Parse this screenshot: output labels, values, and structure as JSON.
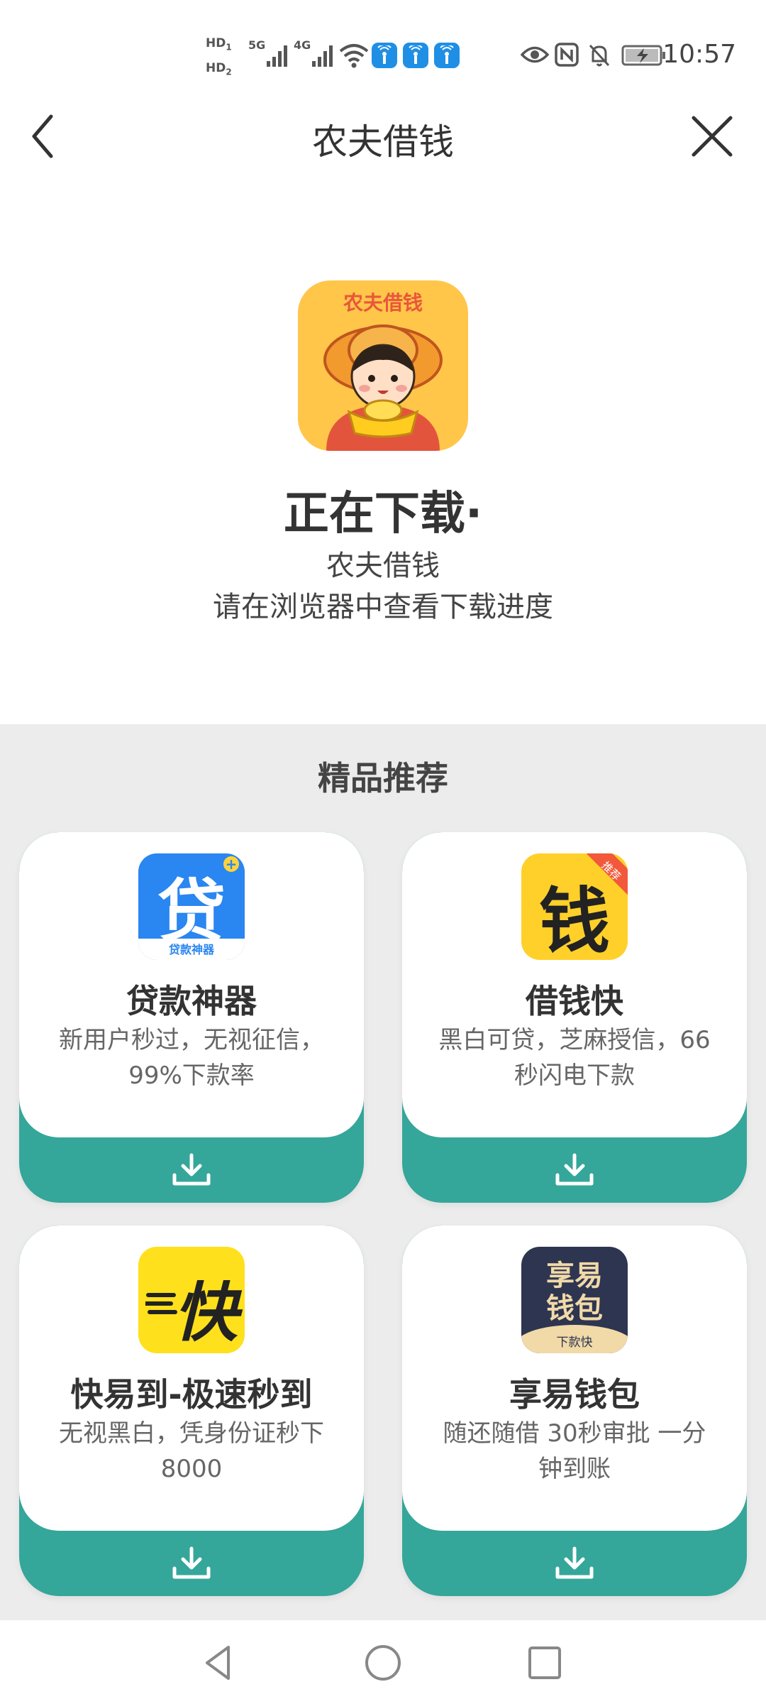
{
  "status_bar": {
    "time": "10:57",
    "hd1": "HD",
    "hd1_sub": "1",
    "hd2": "HD",
    "hd2_sub": "2",
    "net1": "5G",
    "net2": "4G",
    "icons": [
      "eye-icon",
      "nfc-icon",
      "mute-icon",
      "battery-charging-icon"
    ]
  },
  "title_bar": {
    "title": "农夫借钱"
  },
  "download": {
    "icon_text": "农夫借钱",
    "heading": "正在下载·",
    "app_name": "农夫借钱",
    "hint": "请在浏览器中查看下载进度"
  },
  "recommend": {
    "title": "精品推荐",
    "apps": [
      {
        "name": "贷款神器",
        "desc": "新用户秒过，无视征信，99%下款率",
        "icon_glyph": "贷",
        "icon_caption": "贷款神器"
      },
      {
        "name": "借钱快",
        "desc": "黑白可贷，芝麻授信，66秒闪电下款",
        "icon_glyph": "钱",
        "icon_badge": "推荐"
      },
      {
        "name": "快易到-极速秒到",
        "desc": "无视黑白，凭身份证秒下8000",
        "icon_glyph": "快"
      },
      {
        "name": "享易钱包",
        "desc": "随还随借 30秒审批 一分钟到账",
        "icon_glyph_top": "享易",
        "icon_glyph_bottom": "钱包",
        "icon_caption": "下款快"
      }
    ]
  },
  "colors": {
    "accent": "#34a69a",
    "section_bg": "#ececec",
    "icon_main_bg": "#ffc64a"
  }
}
